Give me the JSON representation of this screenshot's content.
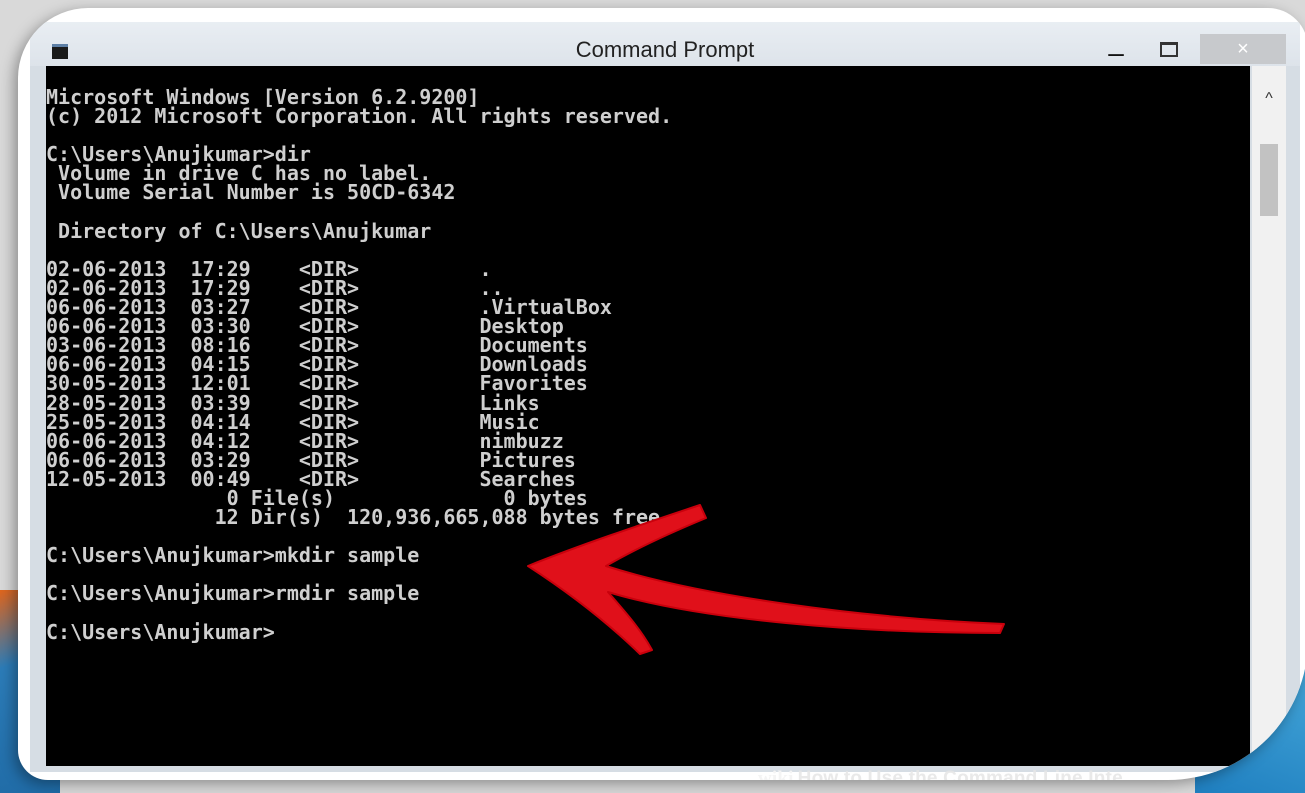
{
  "window": {
    "title": "Command Prompt",
    "buttons": {
      "minimize": "–",
      "maximize": "□",
      "close": "×"
    }
  },
  "scrollbar": {
    "up_arrow": "^"
  },
  "terminal": {
    "lines": [
      "Microsoft Windows [Version 6.2.9200]",
      "(c) 2012 Microsoft Corporation. All rights reserved.",
      "",
      "C:\\Users\\Anujkumar>dir",
      " Volume in drive C has no label.",
      " Volume Serial Number is 50CD-6342",
      "",
      " Directory of C:\\Users\\Anujkumar",
      "",
      "02-06-2013  17:29    <DIR>          .",
      "02-06-2013  17:29    <DIR>          ..",
      "06-06-2013  03:27    <DIR>          .VirtualBox",
      "06-06-2013  03:30    <DIR>          Desktop",
      "03-06-2013  08:16    <DIR>          Documents",
      "06-06-2013  04:15    <DIR>          Downloads",
      "30-05-2013  12:01    <DIR>          Favorites",
      "28-05-2013  03:39    <DIR>          Links",
      "25-05-2013  04:14    <DIR>          Music",
      "06-06-2013  04:12    <DIR>          nimbuzz",
      "06-06-2013  03:29    <DIR>          Pictures",
      "12-05-2013  00:49    <DIR>          Searches",
      "               0 File(s)              0 bytes",
      "              12 Dir(s)  120,936,665,088 bytes free",
      "",
      "C:\\Users\\Anujkumar>mkdir sample",
      "",
      "C:\\Users\\Anujkumar>rmdir sample",
      "",
      "C:\\Users\\Anujkumar>"
    ]
  },
  "annotation": {
    "arrow_color": "#e0101a"
  },
  "watermark": {
    "brand": "wiki",
    "text": "How to Use the Command Line Inte"
  },
  "colors": {
    "console_bg": "#000000",
    "console_text": "#cfcfcf",
    "accent_orange": "#e0651c",
    "accent_blue": "#1f7fc0"
  }
}
